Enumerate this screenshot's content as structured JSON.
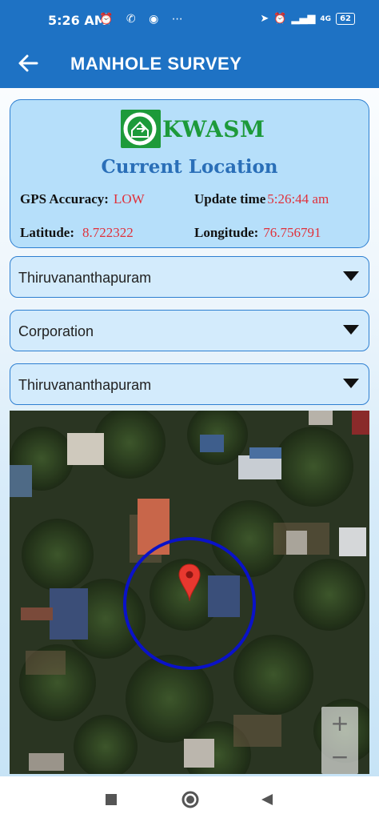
{
  "status_bar": {
    "time": "5:26 AM",
    "battery": "62",
    "network": "4G",
    "icons_left": [
      "alarm-icon",
      "whatsapp-icon",
      "chrome-icon",
      "more-icon"
    ],
    "icons_right": [
      "location-arrow-icon",
      "alarm-icon",
      "signal-icon",
      "volte-icon",
      "signal-4g-icon",
      "battery-icon"
    ]
  },
  "app_bar": {
    "title": "MANHOLE SURVEY",
    "back_icon": "back-arrow-icon"
  },
  "location_card": {
    "logo_text": "KWASM",
    "title": "Current Location",
    "gps_accuracy_label": "GPS Accuracy:",
    "gps_accuracy_value": "LOW",
    "update_time_label": "Update time",
    "update_time_value": "5:26:44 am",
    "latitude_label": "Latitude:",
    "latitude_value": "8.722322",
    "longitude_label": "Longitude:",
    "longitude_value": "76.756791"
  },
  "dropdowns": {
    "district": {
      "selected": "Thiruvananthapuram"
    },
    "body_type": {
      "selected": "Corporation"
    },
    "local_body": {
      "selected": "Thiruvananthapuram"
    }
  },
  "map": {
    "zoom_in_label": "+",
    "zoom_out_label": "−",
    "marker_icon": "map-pin-icon",
    "accuracy_circle_color": "#0a12c8"
  },
  "colors": {
    "primary": "#1e72c4",
    "accent_red": "#e0313b",
    "logo_green": "#1d9a3a"
  }
}
